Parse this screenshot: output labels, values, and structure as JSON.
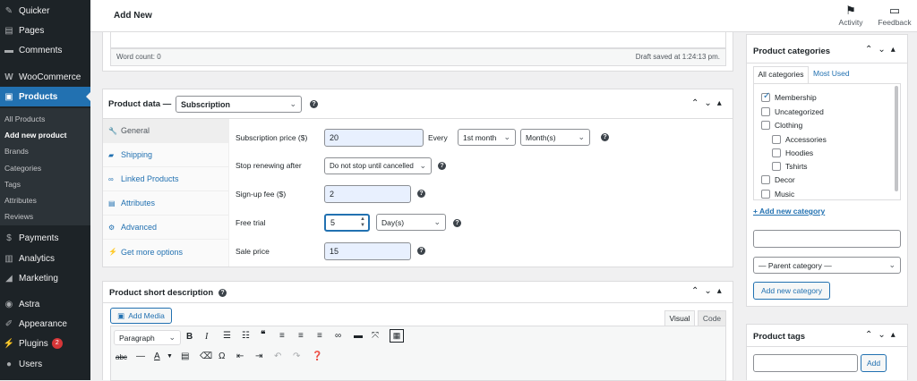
{
  "sidebar": {
    "items": [
      {
        "label": "Quicker",
        "icon": "quicker-icon"
      },
      {
        "label": "Pages",
        "icon": "pages-icon"
      },
      {
        "label": "Comments",
        "icon": "comments-icon"
      },
      {
        "label": "WooCommerce",
        "icon": "woocommerce-icon"
      },
      {
        "label": "Products",
        "icon": "products-icon"
      },
      {
        "label": "Payments",
        "icon": "payments-icon"
      },
      {
        "label": "Analytics",
        "icon": "analytics-icon"
      },
      {
        "label": "Marketing",
        "icon": "marketing-icon"
      },
      {
        "label": "Astra",
        "icon": "astra-icon"
      },
      {
        "label": "Appearance",
        "icon": "appearance-icon"
      },
      {
        "label": "Plugins",
        "icon": "plugins-icon",
        "badge": "2"
      },
      {
        "label": "Users",
        "icon": "users-icon"
      }
    ],
    "submenu": [
      "All Products",
      "Add new product",
      "Brands",
      "Categories",
      "Tags",
      "Attributes",
      "Reviews"
    ]
  },
  "topbar": {
    "title": "Add New",
    "activity_label": "Activity",
    "feedback_label": "Feedback"
  },
  "editor_status": {
    "word_count": "Word count: 0",
    "draft_saved": "Draft saved at 1:24:13 pm."
  },
  "product_data": {
    "title": "Product data —",
    "type_value": "Subscription",
    "tabs": [
      "General",
      "Shipping",
      "Linked Products",
      "Attributes",
      "Advanced",
      "Get more options"
    ],
    "subscription_price_label": "Subscription price ($)",
    "subscription_price_value": "20",
    "every_label": "Every",
    "interval_value": "1st month",
    "period_value": "Month(s)",
    "stop_renewing_label": "Stop renewing after",
    "stop_renewing_value": "Do not stop until cancelled",
    "signup_fee_label": "Sign-up fee ($)",
    "signup_fee_value": "2",
    "free_trial_label": "Free trial",
    "free_trial_value": "5",
    "free_trial_unit": "Day(s)",
    "sale_price_label": "Sale price",
    "sale_price_value": "15"
  },
  "short_description": {
    "title": "Product short description",
    "add_media_label": "Add Media",
    "visual_tab": "Visual",
    "code_tab": "Code",
    "format_value": "Paragraph"
  },
  "categories": {
    "title": "Product categories",
    "tab_all": "All categories",
    "tab_most_used": "Most Used",
    "items": [
      {
        "label": "Membership",
        "checked": true
      },
      {
        "label": "Uncategorized",
        "checked": false
      },
      {
        "label": "Clothing",
        "checked": false
      },
      {
        "label": "Accessories",
        "checked": false
      },
      {
        "label": "Hoodies",
        "checked": false
      },
      {
        "label": "Tshirts",
        "checked": false
      },
      {
        "label": "Decor",
        "checked": false
      },
      {
        "label": "Music",
        "checked": false
      }
    ],
    "add_new_link": "+ Add new category",
    "new_category_value": "",
    "parent_value": "— Parent category —",
    "add_button": "Add new category"
  },
  "tags": {
    "title": "Product tags",
    "input_value": "",
    "add_button": "Add"
  },
  "colors": {
    "sidebar": "#1d2327",
    "accent": "#2271b1",
    "badge": "#d63638"
  }
}
